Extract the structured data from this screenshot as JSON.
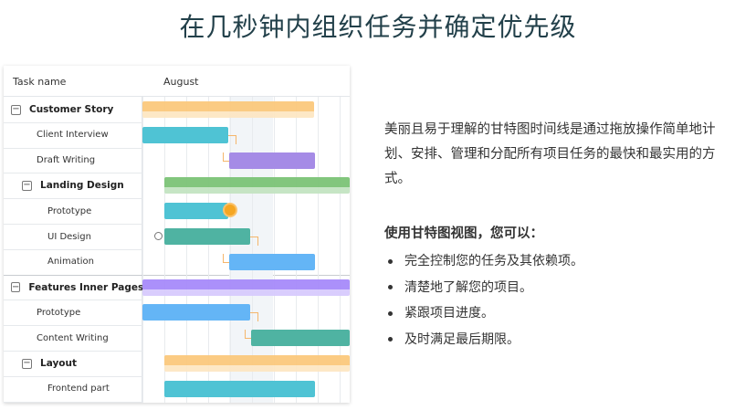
{
  "headline": "在几秒钟内组织任务并确定优先级",
  "gantt": {
    "header": {
      "task_col": "Task name",
      "month": "August"
    },
    "rows": [
      {
        "label": "Customer Story",
        "type": "group",
        "level": 0
      },
      {
        "label": "Client Interview",
        "type": "task",
        "level": 1
      },
      {
        "label": "Draft Writing",
        "type": "task",
        "level": 1
      },
      {
        "label": "Landing Design",
        "type": "group",
        "level": 1
      },
      {
        "label": "Prototype",
        "type": "task",
        "level": 2
      },
      {
        "label": "UI Design",
        "type": "task",
        "level": 2
      },
      {
        "label": "Animation",
        "type": "task",
        "level": 2
      },
      {
        "label": "Features Inner Pages",
        "type": "group",
        "level": 0
      },
      {
        "label": "Prototype",
        "type": "task",
        "level": 1
      },
      {
        "label": "Content Writing",
        "type": "task",
        "level": 1
      },
      {
        "label": "Layout",
        "type": "group",
        "level": 1
      },
      {
        "label": "Frontend part",
        "type": "task",
        "level": 2
      }
    ],
    "toggle_symbol": "−",
    "colors": {
      "orange": "#fbc97d",
      "teal": "#4fc3d4",
      "purple": "#a58be6",
      "green": "#7cc477",
      "green_dark": "#4fb3a2",
      "blue": "#64b5f6",
      "violet": "#a78bfa"
    }
  },
  "description": "美丽且易于理解的甘特图时间线是通过拖放操作简单地计划、安排、管理和分配所有项目任务的最快和最实用的方式。",
  "subhead": "使用甘特图视图，您可以：",
  "features": [
    "完全控制您的任务及其依赖项。",
    "清楚地了解您的项目。",
    "紧跟项目进度。",
    "及时满足最后期限。"
  ]
}
